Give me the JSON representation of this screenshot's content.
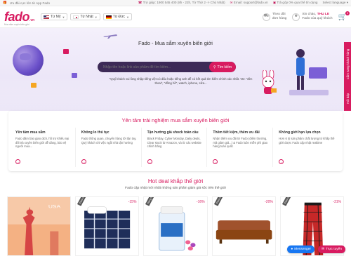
{
  "topstrip": {
    "left": [
      {
        "icon": "gift-icon",
        "text": "Ưu đãi cực lớn từ App Fado"
      }
    ],
    "right": [
      {
        "icon": "phone-icon",
        "text": "Trợ giúp: 1900 545 400 (8h - 22h, Từ Thứ 2 -> Chủ Nhật)"
      },
      {
        "icon": "mail-icon",
        "text": "Email: support@fado.vn"
      },
      {
        "icon": "card-icon",
        "text": "Trả góp 0% qua thẻ tín dụng"
      },
      {
        "icon": "",
        "text": "Select language"
      }
    ]
  },
  "header": {
    "logo": "fado",
    "logo_suffix": ".vn",
    "logo_tagline": "Mua sắm xuyên biên giới",
    "selectors": [
      {
        "flag": "us",
        "label": "Từ Mỹ"
      },
      {
        "flag": "jp",
        "label": "Từ Nhật"
      },
      {
        "flag": "de",
        "label": "Từ Đức"
      }
    ],
    "track_order": {
      "line1": "Theo dõi",
      "line2": "đơn hàng"
    },
    "account": {
      "greeting": "Xin chào,",
      "name": "THU LE",
      "line2": "Fado của quý khách"
    },
    "cart_count": "0"
  },
  "hero": {
    "title": "Fado - Mua sắm xuyên biên giới",
    "search_placeholder": "Nhập tên hoặc link sản phẩm để tìm kiếm...",
    "search_button": "Tìm kiếm",
    "hint": "*Quý khách vui lòng nhập tiếng việt có dấu hoặc tiếng anh để có kết quả tìm kiếm chính xác nhất. VD: \"đèn thoai\", \"đồng hồ\", watch, iphone, sữa..."
  },
  "side_tab": {
    "items": [
      "Cẩm nang khách hàng",
      "Hỏi đáp"
    ]
  },
  "experience": {
    "title": "Yên tâm trải nghiệm mua sắm xuyên biên giới",
    "cards": [
      {
        "title": "Yên tâm mua sắm",
        "desc": "Fado đảm bảo giao dịch, hỗ trợ khiếu nại đối trả xuyên biên giới dễ dàng, bảo vệ người mua..."
      },
      {
        "title": "Không lo thủ tục",
        "desc": "Fado thông quan, chuyển hàng tới tận tay, Quý khách chỉ việc ngồi nhà tận hưởng"
      },
      {
        "title": "Tận hưởng giá shock toàn cầu",
        "desc": "Black Friday, Cyber Monday, Daily deals, Clear stock từ Amazon, và từ các website chính hãng"
      },
      {
        "title": "Thêm tiết kiệm, thêm ưu đãi",
        "desc": "Nhận thêm ưu đãi từ Fado (điểm thưởng, mã giảm giá...) & Fado luôn miễn phí giao hàng toàn quốc"
      },
      {
        "title": "Không giới hạn lựa chọn",
        "desc": "Hơn 6 tỷ sản phẩm chất lượng từ khắp thế giới được Fado cập nhật realtime"
      }
    ]
  },
  "hotdeal": {
    "title": "Hot deal khắp thế giới",
    "subtitle": "Fado cập nhật mới nhất những sản phẩm giảm giá sốc trên thế giới",
    "products": [
      {
        "ribbon": "",
        "discount": "",
        "image": "usa-statue-image",
        "overlay": "USA"
      },
      {
        "ribbon": "Giao từ 36h",
        "discount": "-15%",
        "image": "plaid-bedding-image",
        "overlay": ""
      },
      {
        "ribbon": "Hàng từ Mỹ",
        "discount": "-16%",
        "image": "vitamin-bottle-image",
        "overlay": ""
      },
      {
        "ribbon": "Giao từ 36h",
        "discount": "-20%",
        "image": "leather-sofa-image",
        "overlay": ""
      },
      {
        "ribbon": "Giao từ 36h",
        "discount": "-31%",
        "image": "plaid-pants-image",
        "overlay": ""
      }
    ]
  },
  "floating": {
    "messenger": "Messenger",
    "live_chat": "Trực tuyến"
  },
  "colors": {
    "brand": "#d81b60",
    "search_bg": "#3d2a57"
  }
}
